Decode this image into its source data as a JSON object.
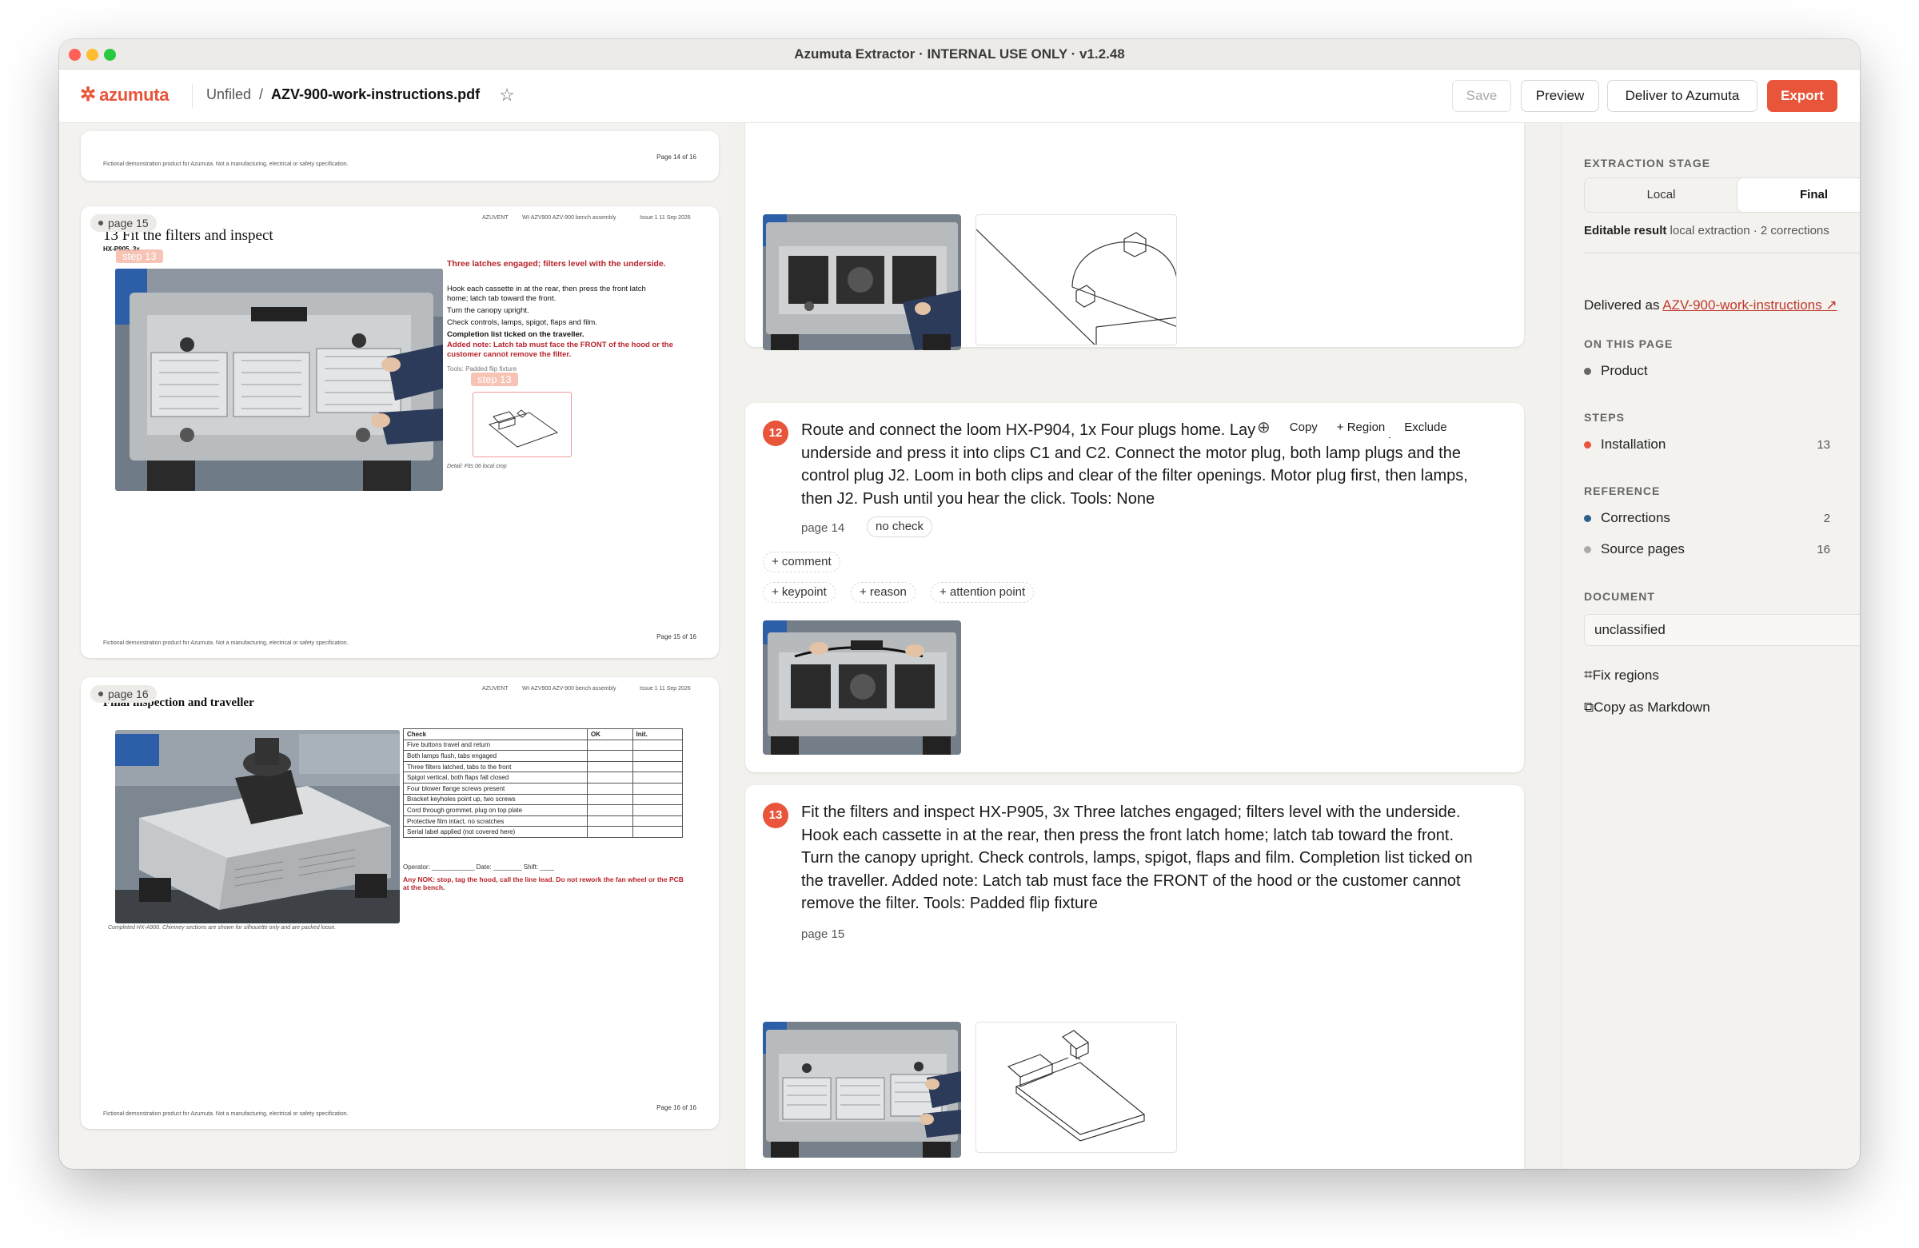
{
  "window": {
    "title": "Azumuta Extractor · INTERNAL USE ONLY · v1.2.48"
  },
  "app": {
    "logo": "azumuta",
    "breadcrumb": {
      "folder": "Unfiled",
      "separator": "/",
      "file": "AZV-900-work-instructions.pdf"
    },
    "actions": {
      "save": "Save",
      "preview": "Preview",
      "deliver": "Deliver to Azumuta",
      "export": "Export"
    },
    "accent": "#e8553b"
  },
  "pdf": {
    "page14": {
      "footer_left": "Fictional demonstration product for Azumuta. Not a manufacturing, electrical or safety specification.",
      "footer_right": "Page 14 of 16"
    },
    "page15": {
      "pill": "page 15",
      "header": {
        "company": "AZUVENT",
        "doc": "WI-AZV900  AZV-900 bench assembly",
        "issue": "Issue 1  11 Sep 2026"
      },
      "title": "13  Fit the filters and inspect",
      "part": "HX-P905, 3x",
      "step_tag": "step 13",
      "step_tag_2": "step 13",
      "red_heading": "Three latches engaged; filters level with the underside.",
      "lines": [
        "Hook each cassette in at the rear, then press the front latch",
        "home; latch tab toward the front.",
        "Turn the canopy upright.",
        "Check controls, lamps, spigot, flaps and film."
      ],
      "bold_line": "Completion list ticked on the traveller.",
      "red_note": "Added note: Latch tab must face the FRONT of the hood or the customer cannot remove the filter.",
      "tools": "Tools: Padded flip fixture",
      "detail_caption": "Detail: Fits 06 local crop",
      "footer_left": "Fictional demonstration product for Azumuta. Not a manufacturing, electrical or safety specification.",
      "footer_right": "Page 15 of 16"
    },
    "page16": {
      "pill": "page 16",
      "header": {
        "company": "AZUVENT",
        "doc": "WI-AZV900  AZV-900 bench assembly",
        "issue": "Issue 1  11 Sep 2026"
      },
      "title": "Final inspection and traveller",
      "table_headers": [
        "Check",
        "OK",
        "Init."
      ],
      "table_rows": [
        "Five buttons travel and return",
        "Both lamps flush, tabs engaged",
        "Three filters latched, tabs to the front",
        "Spigot vertical, both flaps fall closed",
        "Four blower flange screws present",
        "Bracket keyholes point up, two screws",
        "Cord through grommet, plug on top plate",
        "Protective film intact, no scratches",
        "Serial label applied (not covered here)"
      ],
      "signoff": "Operator: ____________   Date: ________   Shift: ____",
      "nok": "Any NOK: stop, tag the hood, call the line lead. Do not rework the fan wheel or the PCB at the bench.",
      "caption": "Completed HX-A900. Chimney sections are shown for silhouette only and are packed loose.",
      "footer_left": "Fictional demonstration product for Azumuta. Not a manufacturing, electrical or safety specification.",
      "footer_right": "Page 16 of 16"
    }
  },
  "steps": [
    {
      "number": "12",
      "text": "Route and connect the loom HX-P904, 1x Four plugs home. Lay the loom over the plate underside and press it into clips C1 and C2. Connect the motor plug, both lamp plugs and the control plug J2. Loom in both clips and clear of the filter openings. Motor plug first, then lamps, then J2. Push until you hear the click. Tools: None",
      "page": "page 14",
      "check": "no check",
      "toolbar": {
        "copy": "Copy",
        "region": "+ Region",
        "exclude": "Exclude"
      },
      "add_buttons": [
        "+ comment",
        "+ keypoint",
        "+ reason",
        "+ attention point"
      ]
    },
    {
      "number": "13",
      "text": "Fit the filters and inspect HX-P905, 3x Three latches engaged; filters level with the underside. Hook each cassette in at the rear, then press the front latch home; latch tab toward the front. Turn the canopy upright. Check controls, lamps, spigot, flaps and film. Completion list ticked on the traveller. Added note: Latch tab must face the FRONT of the hood or the customer cannot remove the filter. Tools: Padded flip fixture",
      "page": "page 15"
    }
  ],
  "sidebar": {
    "stage_label": "EXTRACTION STAGE",
    "stage_options": [
      "Local",
      "Final"
    ],
    "stage_selected": "Final",
    "editable_label": "Editable result",
    "editable_detail": "local extraction · 2 corrections",
    "delivered_label": "Delivered as",
    "delivered_link": "AZV-900-work-instructions ↗",
    "on_this_page": "ON THIS PAGE",
    "product": "Product",
    "steps_label": "STEPS",
    "installation": "Installation",
    "installation_count": "13",
    "reference_label": "REFERENCE",
    "corrections": "Corrections",
    "corrections_count": "2",
    "source_pages": "Source pages",
    "source_pages_count": "16",
    "document_label": "DOCUMENT",
    "document_value": "unclassified",
    "fix_regions": "Fix regions",
    "copy_markdown": "Copy as Markdown"
  }
}
